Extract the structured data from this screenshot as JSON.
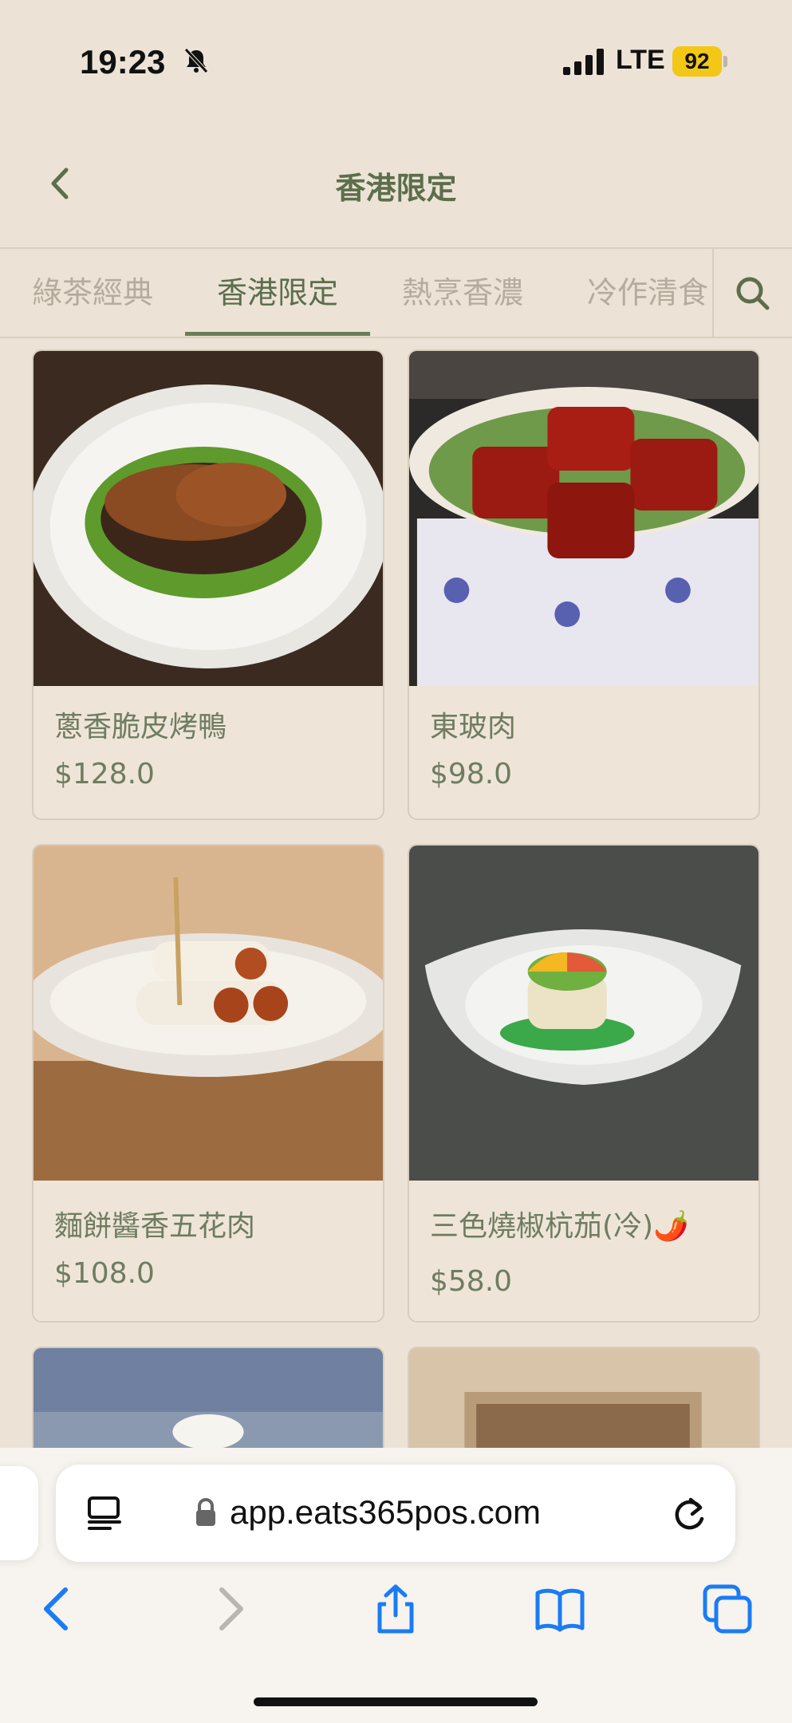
{
  "status": {
    "time": "19:23",
    "network": "LTE",
    "battery": "92"
  },
  "header": {
    "title": "香港限定"
  },
  "tabs": [
    {
      "label": "綠茶經典",
      "active": false
    },
    {
      "label": "香港限定",
      "active": true
    },
    {
      "label": "熱烹香濃",
      "active": false
    },
    {
      "label": "冷作清食",
      "active": false
    }
  ],
  "items": [
    {
      "name": "蔥香脆皮烤鴨",
      "price": "$128.0"
    },
    {
      "name": "東玻肉",
      "price": "$98.0"
    },
    {
      "name": "麵餅醬香五花肉",
      "price": "$108.0"
    },
    {
      "name": "三色燒椒杭茄(冷)🌶️",
      "price": "$58.0"
    }
  ],
  "browser": {
    "url": "app.eats365pos.com"
  },
  "colors": {
    "accent": "#5c6e4c",
    "background": "#ece3d6",
    "ios_blue": "#1a7cf5"
  },
  "icons": [
    "back-chevron-icon",
    "search-icon",
    "silent-bell-icon",
    "lock-icon",
    "reader-icon",
    "reload-icon",
    "share-icon",
    "bookmarks-icon",
    "tabs-icon"
  ]
}
